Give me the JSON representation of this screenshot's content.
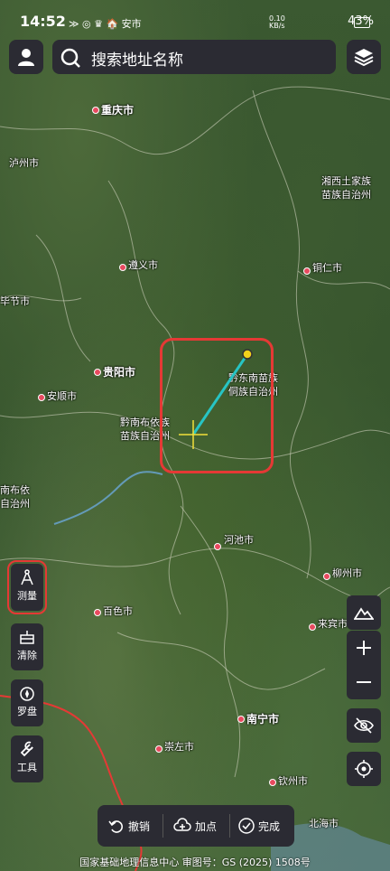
{
  "status_bar": {
    "time": "14:52",
    "misc": "≫ ◎ ♛ 🏠 安市",
    "network": "0.10 KB/s",
    "battery": "43%"
  },
  "search": {
    "placeholder": "搜索地址名称"
  },
  "map_labels": {
    "chongqing": "重庆市",
    "luzhou": "泸州市",
    "xiangxi": "湘西土家族\n苗族自治州",
    "zunyi": "遵义市",
    "tongren": "铜仁市",
    "bijie": "毕节市",
    "guiyang": "贵阳市",
    "qiandongnan": "黔东南苗族\n侗族自治州",
    "anshun": "安顺市",
    "qiannan": "黔南布依族\n苗族自治州",
    "qianxinan": "南布依\n自治州",
    "hechi": "河池市",
    "liuzhou": "柳州市",
    "baise": "百色市",
    "laibin": "来宾市",
    "nanning": "南宁市",
    "chongzuo": "崇左市",
    "qinzhou": "钦州市",
    "beihai": "北海市"
  },
  "tools": {
    "measure": "测量",
    "clear": "清除",
    "compass": "罗盘",
    "tools": "工具"
  },
  "bottom_bar": {
    "undo": "撤销",
    "add_point": "加点",
    "done": "完成"
  },
  "footer": "国家基础地理信息中心  审图号：GS (2025) 1508号",
  "colors": {
    "measure_line": "#27c4c4",
    "endpoint": "#f2d21b",
    "crosshair": "#f2e03a",
    "highlight": "#e53935",
    "panel_bg": "#2b2b33"
  }
}
